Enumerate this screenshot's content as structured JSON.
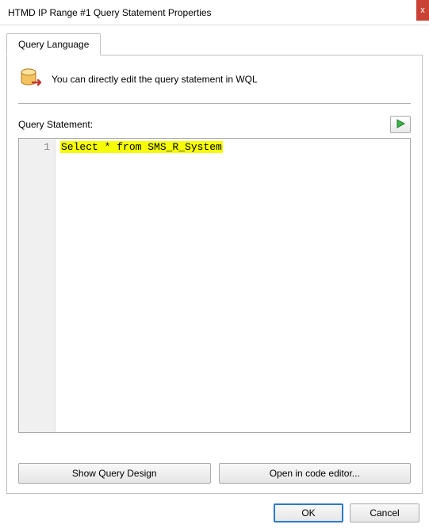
{
  "window": {
    "title": "HTMD IP Range #1 Query Statement Properties",
    "close_label": "x"
  },
  "tab": {
    "label": "Query Language"
  },
  "info": {
    "text": "You can directly edit the query statement in WQL"
  },
  "query": {
    "label": "Query Statement:",
    "line_number": "1",
    "code": "Select * from SMS_R_System"
  },
  "buttons": {
    "show_design": "Show Query Design",
    "open_editor": "Open in code editor...",
    "ok": "OK",
    "cancel": "Cancel"
  },
  "icons": {
    "db": "database-arrow-icon",
    "run": "run-icon",
    "close": "close-icon"
  }
}
